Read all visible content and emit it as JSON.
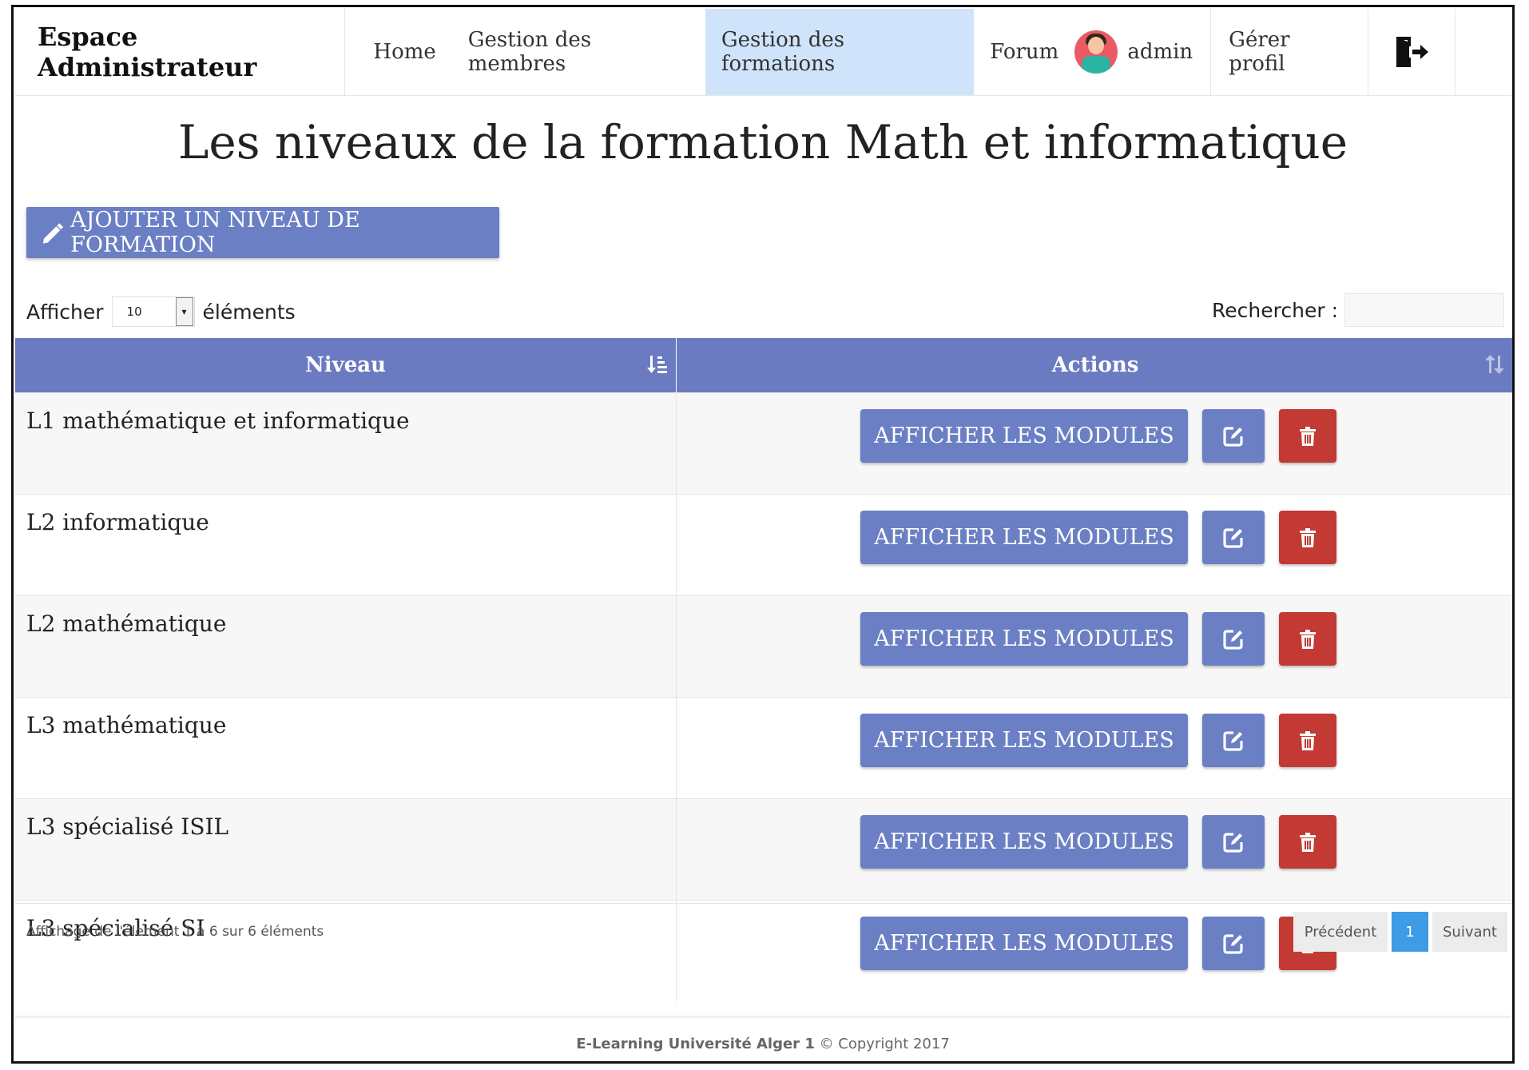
{
  "nav": {
    "brand": "Espace Administrateur",
    "links": [
      {
        "label": "Home"
      },
      {
        "label": "Gestion des membres"
      },
      {
        "label": "Gestion des formations"
      },
      {
        "label": "Forum"
      }
    ],
    "user": "admin",
    "profile": "Gérer profil",
    "logout_icon": "logout-icon",
    "active_color": "#cfe4fa"
  },
  "page": {
    "title": "Les niveaux de la formation Math et informatique",
    "add_button": "AJOUTER UN NIVEAU DE FORMATION"
  },
  "table_controls": {
    "length_prefix": "Afficher",
    "length_value": "10",
    "length_suffix": "éléments",
    "search_label": "Rechercher :"
  },
  "table": {
    "headers": [
      "Niveau",
      "Actions"
    ],
    "rows": [
      {
        "niveau": "L1 mathématique et informatique",
        "modules_label": "AFFICHER LES MODULES"
      },
      {
        "niveau": "L2 informatique",
        "modules_label": "AFFICHER LES MODULES"
      },
      {
        "niveau": "L2 mathématique",
        "modules_label": "AFFICHER LES MODULES"
      },
      {
        "niveau": "L3 mathématique",
        "modules_label": "AFFICHER LES MODULES"
      },
      {
        "niveau": "L3 spécialisé ISIL",
        "modules_label": "AFFICHER LES MODULES"
      },
      {
        "niveau": "L3 spécialisé SI",
        "modules_label": "AFFICHER LES MODULES"
      }
    ]
  },
  "info": "Affichage de l'élement 1 à 6 sur 6 éléments",
  "pager": {
    "prev": "Précédent",
    "current": "1",
    "next": "Suivant"
  },
  "footer": {
    "strong": "E-Learning Université Alger 1",
    "rest": " © Copyright 2017"
  },
  "colors": {
    "primary": "#6a7fc4",
    "danger": "#c23a33",
    "header": "#6a7bc2",
    "pager_active": "#3e9be6"
  }
}
